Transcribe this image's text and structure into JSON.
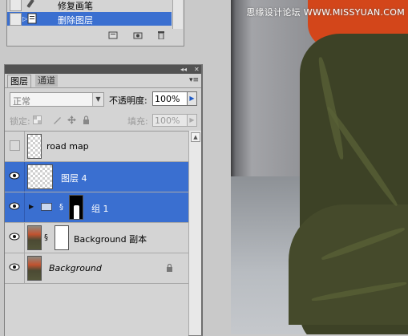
{
  "history": {
    "items": [
      {
        "label": "修复画笔",
        "selected": false
      },
      {
        "label": "删除图层",
        "selected": true
      }
    ],
    "tool_icons": [
      "new-snapshot-icon",
      "camera-icon",
      "trash-icon"
    ]
  },
  "layers_panel": {
    "tabs": [
      {
        "label": "图层",
        "active": true
      },
      {
        "label": "通道",
        "active": false
      }
    ],
    "blend_mode": "正常",
    "opacity_label": "不透明度:",
    "opacity_value": "100%",
    "lock_label": "锁定:",
    "fill_label": "填充:",
    "fill_value": "100%",
    "layers": [
      {
        "name": "road map",
        "visible": false,
        "selected": false,
        "kind": "transparent"
      },
      {
        "name": "图层 4",
        "visible": true,
        "selected": true,
        "kind": "transparent"
      },
      {
        "name": "组 1",
        "visible": true,
        "selected": true,
        "kind": "group-with-mask"
      },
      {
        "name": "Background 副本",
        "visible": true,
        "selected": false,
        "kind": "photo-with-mask"
      },
      {
        "name": "Background",
        "visible": true,
        "selected": false,
        "kind": "background",
        "locked": true
      }
    ]
  },
  "watermark": "思缘设计论坛 WWW.MISSYUAN.COM",
  "colors": {
    "selection": "#3a6fd0",
    "panel_bg": "#d4d4d4",
    "shirt": "#d3461a",
    "skirt": "#3d4226"
  }
}
